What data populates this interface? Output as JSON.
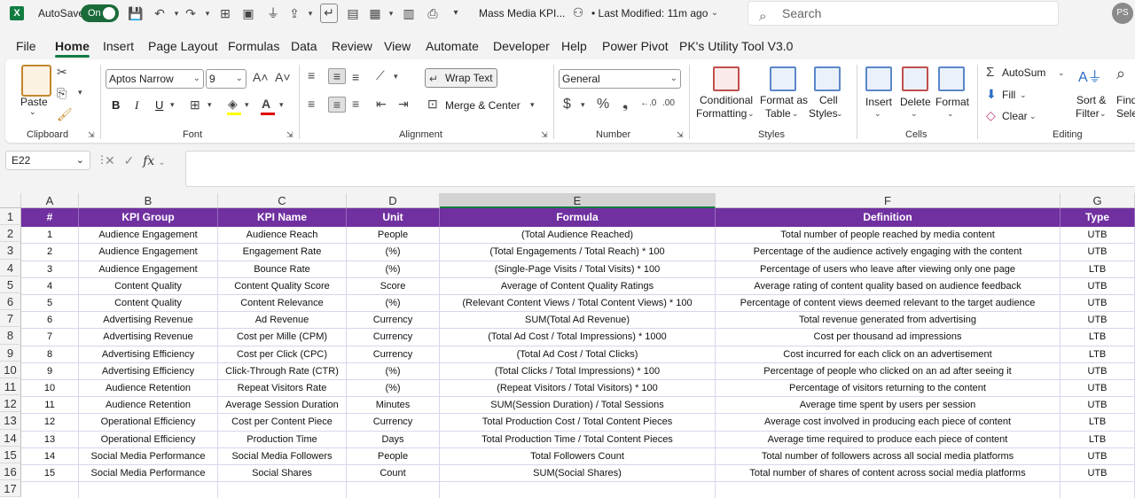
{
  "titlebar": {
    "autosave_label": "AutoSave",
    "toggle_label": "On",
    "doc_title": "Mass Media KPI...",
    "modified": "• Last Modified: 11m ago",
    "search_placeholder": "Search",
    "avatar_initials": "PS"
  },
  "tabs": [
    "File",
    "Home",
    "Insert",
    "Page Layout",
    "Formulas",
    "Data",
    "Review",
    "View",
    "Automate",
    "Developer",
    "Help",
    "Power Pivot",
    "PK's Utility Tool V3.0"
  ],
  "active_tab": "Home",
  "ribbon": {
    "clipboard": {
      "paste": "Paste",
      "label": "Clipboard"
    },
    "font": {
      "name": "Aptos Narrow",
      "size": "9",
      "label": "Font",
      "bold": "B",
      "italic": "I",
      "underline": "U"
    },
    "alignment": {
      "wrap_text": "Wrap Text",
      "merge_center": "Merge & Center",
      "label": "Alignment"
    },
    "number": {
      "format": "General",
      "label": "Number"
    },
    "styles": {
      "conditional": "Conditional",
      "conditional2": "Formatting",
      "format_as": "Format as",
      "format_as2": "Table",
      "cell": "Cell",
      "cell2": "Styles",
      "label": "Styles"
    },
    "cells": {
      "insert": "Insert",
      "delete": "Delete",
      "format": "Format",
      "label": "Cells"
    },
    "editing": {
      "autosum": "AutoSum",
      "fill": "Fill",
      "clear": "Clear",
      "sort": "Sort &",
      "sort2": "Filter",
      "find": "Find",
      "find2": "Selec",
      "label": "Editing"
    }
  },
  "formula_bar": {
    "name_box": "E22",
    "fx": "fx",
    "formula": ""
  },
  "columns": [
    "A",
    "B",
    "C",
    "D",
    "E",
    "F",
    "G"
  ],
  "selected_column": "E",
  "row_numbers": [
    "1",
    "2",
    "3",
    "4",
    "5",
    "6",
    "7",
    "8",
    "9",
    "10",
    "11",
    "12",
    "13",
    "14",
    "15",
    "16",
    "17"
  ],
  "headers": [
    "#",
    "KPI Group",
    "KPI Name",
    "Unit",
    "Formula",
    "Definition",
    "Type"
  ],
  "rows": [
    [
      "1",
      "Audience Engagement",
      "Audience Reach",
      "People",
      "(Total Audience Reached)",
      "Total number of people reached by media content",
      "UTB"
    ],
    [
      "2",
      "Audience Engagement",
      "Engagement Rate",
      "(%)",
      "(Total Engagements / Total Reach) * 100",
      "Percentage of the audience actively engaging with the content",
      "UTB"
    ],
    [
      "3",
      "Audience Engagement",
      "Bounce Rate",
      "(%)",
      "(Single-Page Visits / Total Visits) * 100",
      "Percentage of users who leave after viewing only one page",
      "LTB"
    ],
    [
      "4",
      "Content Quality",
      "Content Quality Score",
      "Score",
      "Average of Content Quality Ratings",
      "Average rating of content quality based on audience feedback",
      "UTB"
    ],
    [
      "5",
      "Content Quality",
      "Content Relevance",
      "(%)",
      "(Relevant Content Views / Total Content Views) * 100",
      "Percentage of content views deemed relevant to the target audience",
      "UTB"
    ],
    [
      "6",
      "Advertising Revenue",
      "Ad Revenue",
      "Currency",
      "SUM(Total Ad Revenue)",
      "Total revenue generated from advertising",
      "UTB"
    ],
    [
      "7",
      "Advertising Revenue",
      "Cost per Mille (CPM)",
      "Currency",
      "(Total Ad Cost / Total Impressions) * 1000",
      "Cost per thousand ad impressions",
      "LTB"
    ],
    [
      "8",
      "Advertising Efficiency",
      "Cost per Click (CPC)",
      "Currency",
      "(Total Ad Cost / Total Clicks)",
      "Cost incurred for each click on an advertisement",
      "LTB"
    ],
    [
      "9",
      "Advertising Efficiency",
      "Click-Through Rate (CTR)",
      "(%)",
      "(Total Clicks / Total Impressions) * 100",
      "Percentage of people who clicked on an ad after seeing it",
      "UTB"
    ],
    [
      "10",
      "Audience Retention",
      "Repeat Visitors Rate",
      "(%)",
      "(Repeat Visitors / Total Visitors) * 100",
      "Percentage of visitors returning to the content",
      "UTB"
    ],
    [
      "11",
      "Audience Retention",
      "Average Session Duration",
      "Minutes",
      "SUM(Session Duration) / Total Sessions",
      "Average time spent by users per session",
      "UTB"
    ],
    [
      "12",
      "Operational Efficiency",
      "Cost per Content Piece",
      "Currency",
      "Total Production Cost / Total Content Pieces",
      "Average cost involved in producing each piece of content",
      "LTB"
    ],
    [
      "13",
      "Operational Efficiency",
      "Production Time",
      "Days",
      "Total Production Time / Total Content Pieces",
      "Average time required to produce each piece of content",
      "LTB"
    ],
    [
      "14",
      "Social Media Performance",
      "Social Media Followers",
      "People",
      "Total Followers Count",
      "Total number of followers across all social media platforms",
      "UTB"
    ],
    [
      "15",
      "Social Media Performance",
      "Social Shares",
      "Count",
      "SUM(Social Shares)",
      "Total number of shares of content across social media platforms",
      "UTB"
    ]
  ],
  "colors": {
    "header_bg": "#7030a0",
    "accent": "#107c41"
  }
}
